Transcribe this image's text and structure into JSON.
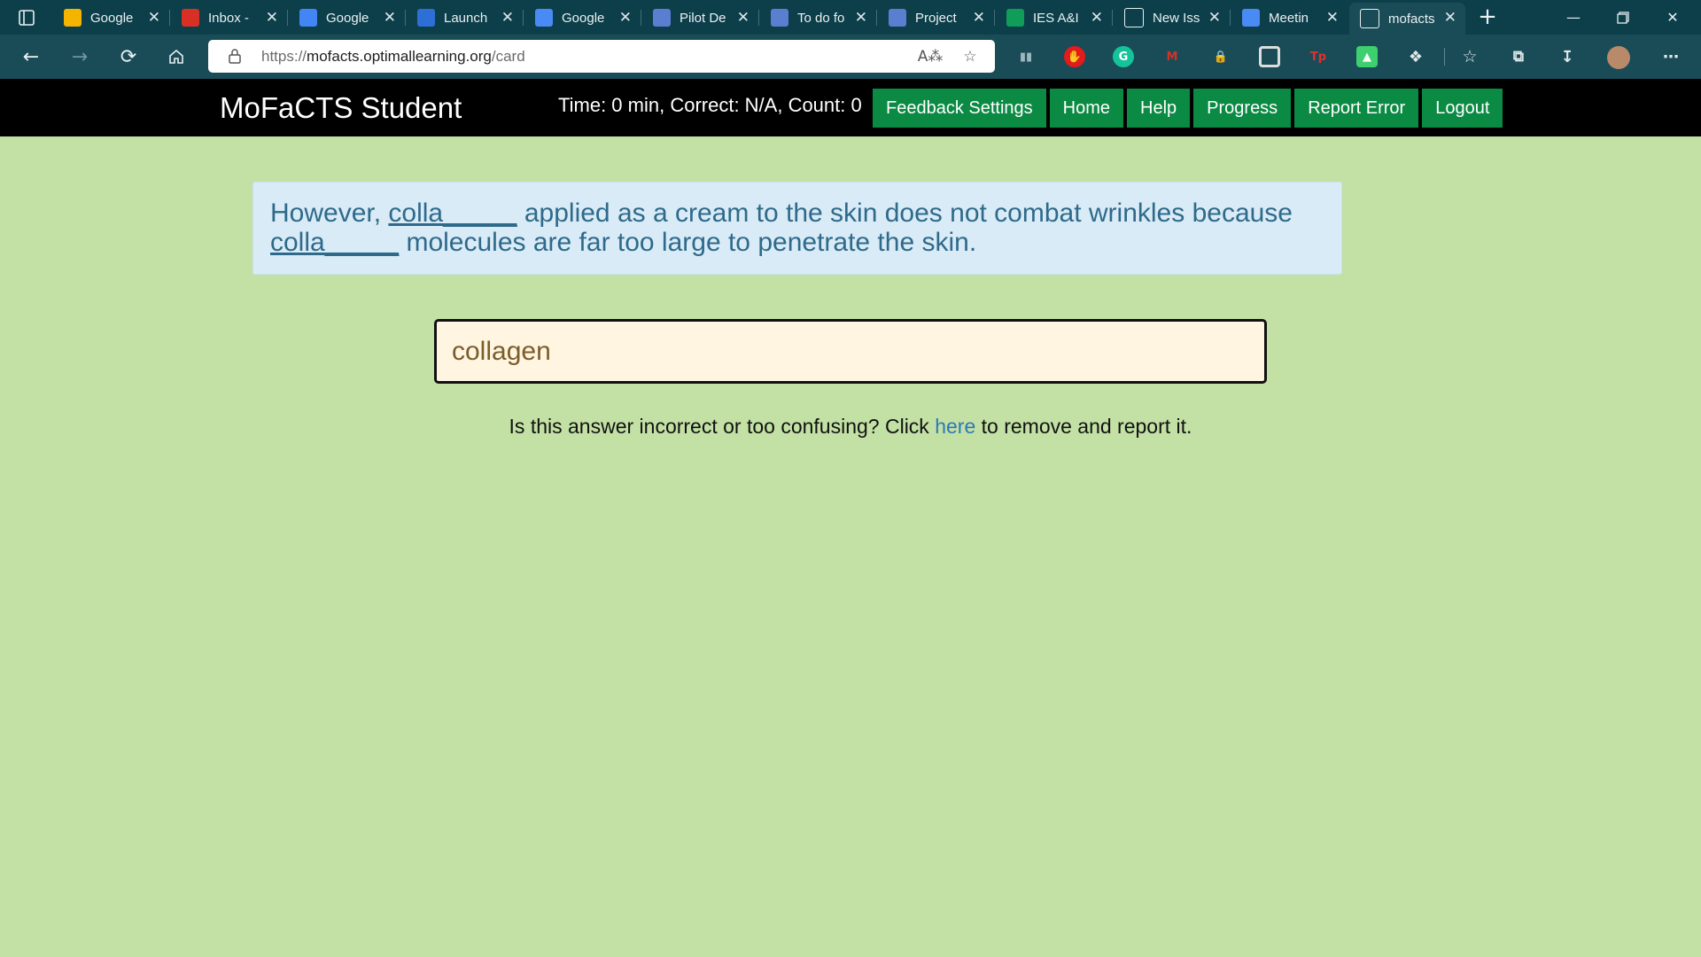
{
  "browser": {
    "tabs": [
      {
        "label": "Google",
        "icon": "google-keep-icon",
        "color": "#f5b400"
      },
      {
        "label": "Inbox -",
        "icon": "gmail-icon",
        "color": "#d93025"
      },
      {
        "label": "Google",
        "icon": "google-calendar-icon",
        "color": "#4285f4"
      },
      {
        "label": "Launch",
        "icon": "meet-icon",
        "color": "#2d6fd6"
      },
      {
        "label": "Google",
        "icon": "google-docs-icon",
        "color": "#4a8af4"
      },
      {
        "label": "Pilot De",
        "icon": "doc-icon",
        "color": "#5b7fd0"
      },
      {
        "label": "To do fo",
        "icon": "doc-icon",
        "color": "#5b7fd0"
      },
      {
        "label": "Project",
        "icon": "doc-icon",
        "color": "#5b7fd0"
      },
      {
        "label": "IES A&I",
        "icon": "sheets-icon",
        "color": "#0f9d58"
      },
      {
        "label": "New Iss",
        "icon": "github-icon",
        "color": "#ffffff"
      },
      {
        "label": "Meetin",
        "icon": "google-docs-icon",
        "color": "#4a8af4"
      },
      {
        "label": "mofacts",
        "icon": "page-icon",
        "color": "#ffffff"
      }
    ],
    "active_tab": 11,
    "url_prefix": "https://",
    "url_host": "mofacts.optimallearning.org",
    "url_path": "/card"
  },
  "app": {
    "brand": "MoFaCTS Student",
    "status": "Time: 0 min, Correct: N/A, Count: 0",
    "nav": {
      "feedback_settings": "Feedback Settings",
      "home": "Home",
      "help": "Help",
      "progress": "Progress",
      "report_error": "Report Error",
      "logout": "Logout"
    }
  },
  "card": {
    "q_part1": "However, ",
    "q_blank1": "colla_____",
    "q_part2": " applied as a cream to the skin does not combat wrinkles because ",
    "q_blank2": "colla_____",
    "q_part3": " molecules are far too large to penetrate the skin.",
    "answer_value": "collagen",
    "report_before": "Is this answer incorrect or too confusing? Click ",
    "report_link": "here",
    "report_after": " to remove and report it."
  },
  "colors": {
    "page_bg": "#c3e1a5",
    "nav_button": "#0b8a44",
    "question_bg": "#d8ebf7",
    "question_text": "#2f6a8a",
    "answer_bg": "#fff5e1"
  }
}
